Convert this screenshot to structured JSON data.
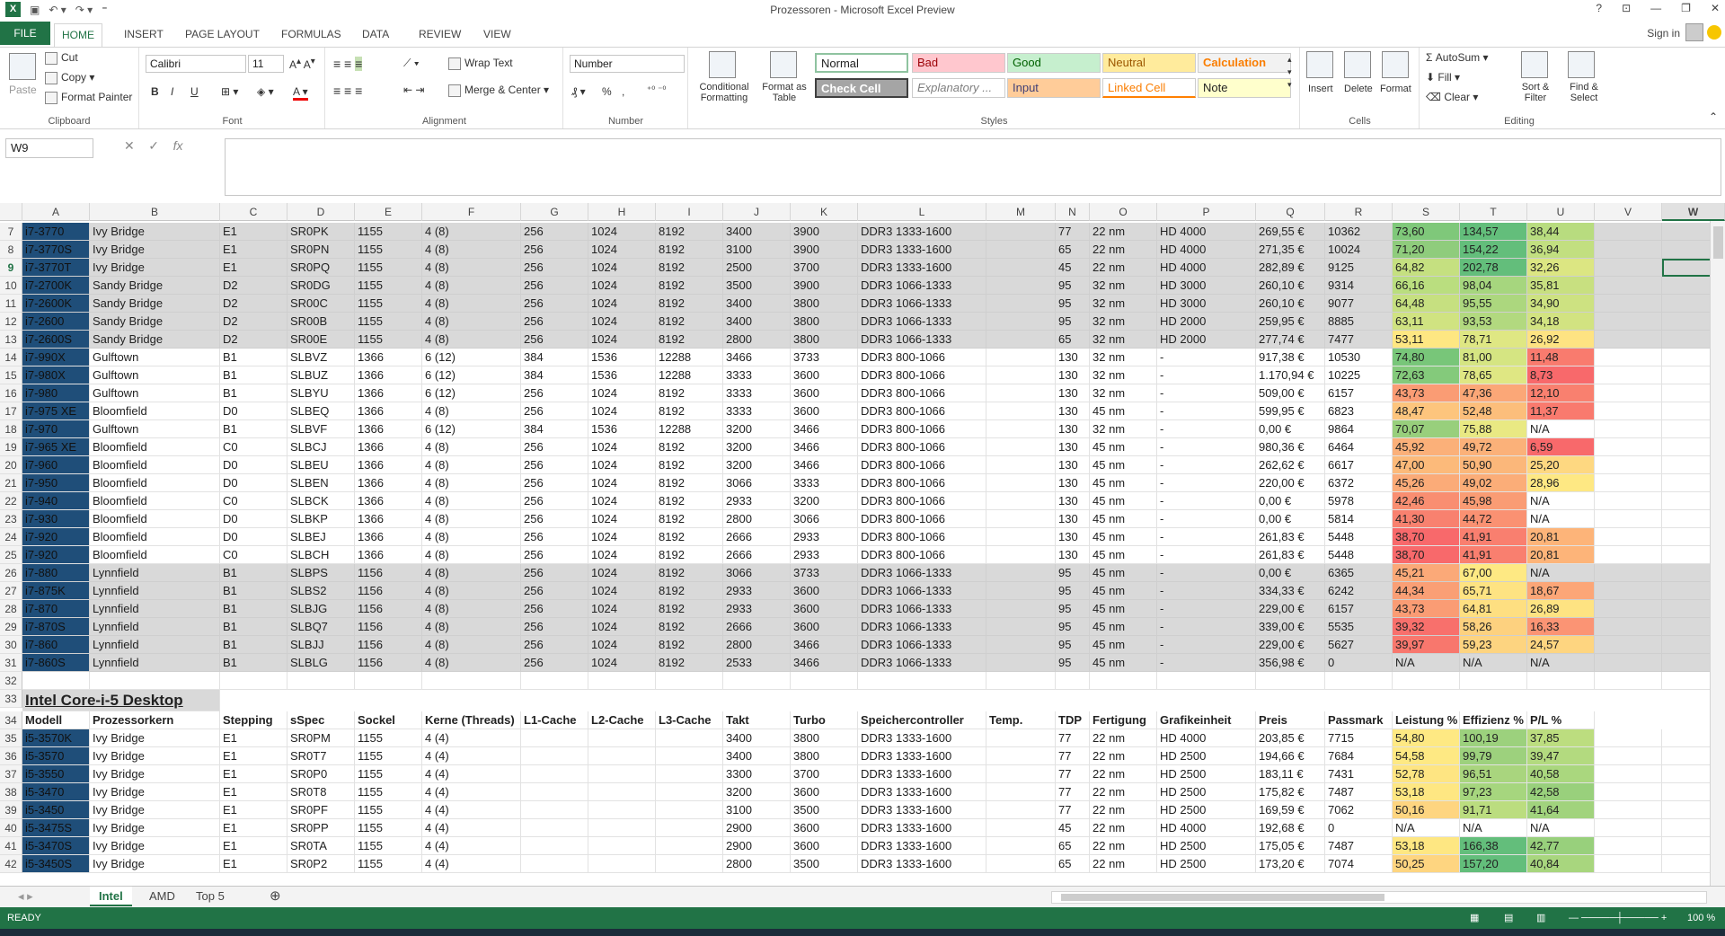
{
  "title": "Prozessoren - Microsoft Excel Preview",
  "tabs": {
    "file": "FILE",
    "home": "HOME",
    "insert": "INSERT",
    "page_layout": "PAGE LAYOUT",
    "formulas": "FORMULAS",
    "data": "DATA",
    "review": "REVIEW",
    "view": "VIEW",
    "signin": "Sign in"
  },
  "clipboard": {
    "paste": "Paste",
    "cut": "Cut",
    "copy": "Copy",
    "format_painter": "Format Painter",
    "label": "Clipboard"
  },
  "font": {
    "name": "Calibri",
    "size": "11",
    "label": "Font",
    "bold": "B",
    "italic": "I",
    "underline": "U"
  },
  "alignment": {
    "wrap": "Wrap Text",
    "merge": "Merge & Center",
    "label": "Alignment"
  },
  "number": {
    "format": "Number",
    "pct": "%",
    "label": "Number"
  },
  "styles": {
    "cond": "Conditional Formatting",
    "fmt_table": "Format as Table",
    "label": "Styles",
    "normal": "Normal",
    "bad": "Bad",
    "good": "Good",
    "neutral": "Neutral",
    "calculation": "Calculation",
    "check": "Check Cell",
    "explanatory": "Explanatory ...",
    "input": "Input",
    "linked": "Linked Cell",
    "note": "Note"
  },
  "cells": {
    "insert": "Insert",
    "delete": "Delete",
    "format": "Format",
    "label": "Cells"
  },
  "editing": {
    "autosum": "AutoSum",
    "fill": "Fill",
    "clear": "Clear",
    "sort": "Sort & Filter",
    "find": "Find & Select",
    "label": "Editing"
  },
  "namebox": "W9",
  "fx": "fx",
  "columns": [
    "A",
    "B",
    "C",
    "D",
    "E",
    "F",
    "G",
    "H",
    "I",
    "J",
    "K",
    "L",
    "M",
    "N",
    "O",
    "P",
    "Q",
    "R",
    "S",
    "T",
    "U",
    "V",
    "W"
  ],
  "rows": [
    {
      "n": "7",
      "grey": true,
      "v": [
        "i7-3770",
        "Ivy Bridge",
        "E1",
        "SR0PK",
        "1155",
        "4 (8)",
        "256",
        "1024",
        "8192",
        "3400",
        "3900",
        "DDR3 1333-1600",
        "",
        "77",
        "22 nm",
        "HD 4000",
        "269,55 €",
        "10362",
        "73,60",
        "134,57",
        "38,44"
      ],
      "col": [
        "#7fc87a",
        "#63be7b",
        "#b8dc7f"
      ]
    },
    {
      "n": "8",
      "grey": true,
      "v": [
        "i7-3770S",
        "Ivy Bridge",
        "E1",
        "SR0PN",
        "1155",
        "4 (8)",
        "256",
        "1024",
        "8192",
        "3100",
        "3900",
        "DDR3 1333-1600",
        "",
        "65",
        "22 nm",
        "HD 4000",
        "271,35 €",
        "10024",
        "71,20",
        "154,22",
        "36,94"
      ],
      "col": [
        "#8fcc7c",
        "#63be7b",
        "#c2df80"
      ]
    },
    {
      "n": "9",
      "grey": true,
      "v": [
        "i7-3770T",
        "Ivy Bridge",
        "E1",
        "SR0PQ",
        "1155",
        "4 (8)",
        "256",
        "1024",
        "8192",
        "2500",
        "3700",
        "DDR3 1333-1600",
        "",
        "45",
        "22 nm",
        "HD 4000",
        "282,89 €",
        "9125",
        "64,82",
        "202,78",
        "32,26"
      ],
      "col": [
        "#c5e080",
        "#63be7b",
        "#dce682"
      ]
    },
    {
      "n": "10",
      "grey": true,
      "v": [
        "i7-2700K",
        "Sandy Bridge",
        "D2",
        "SR0DG",
        "1155",
        "4 (8)",
        "256",
        "1024",
        "8192",
        "3500",
        "3900",
        "DDR3 1066-1333",
        "",
        "95",
        "32 nm",
        "HD 3000",
        "260,10 €",
        "9314",
        "66,16",
        "98,04",
        "35,81"
      ],
      "col": [
        "#bade7f",
        "#a6d67e",
        "#c8e080"
      ]
    },
    {
      "n": "11",
      "grey": true,
      "v": [
        "i7-2600K",
        "Sandy Bridge",
        "D2",
        "SR00C",
        "1155",
        "4 (8)",
        "256",
        "1024",
        "8192",
        "3400",
        "3800",
        "DDR3 1066-1333",
        "",
        "95",
        "32 nm",
        "HD 3000",
        "260,10 €",
        "9077",
        "64,48",
        "95,55",
        "34,90"
      ],
      "col": [
        "#c6e080",
        "#acd77e",
        "#cde281"
      ]
    },
    {
      "n": "12",
      "grey": true,
      "v": [
        "i7-2600",
        "Sandy Bridge",
        "D2",
        "SR00B",
        "1155",
        "4 (8)",
        "256",
        "1024",
        "8192",
        "3400",
        "3800",
        "DDR3 1066-1333",
        "",
        "95",
        "32 nm",
        "HD 2000",
        "259,95 €",
        "8885",
        "63,11",
        "93,53",
        "34,18"
      ],
      "col": [
        "#d0e381",
        "#b2d97f",
        "#d2e381"
      ]
    },
    {
      "n": "13",
      "grey": true,
      "v": [
        "i7-2600S",
        "Sandy Bridge",
        "D2",
        "SR00E",
        "1155",
        "4 (8)",
        "256",
        "1024",
        "8192",
        "2800",
        "3800",
        "DDR3 1066-1333",
        "",
        "65",
        "32 nm",
        "HD 2000",
        "277,74 €",
        "7477",
        "53,11",
        "78,71",
        "26,92"
      ],
      "col": [
        "#fee782",
        "#dfe783",
        "#fee382"
      ]
    },
    {
      "n": "14",
      "grey": false,
      "v": [
        "i7-990X",
        "Gulftown",
        "B1",
        "SLBVZ",
        "1366",
        "6 (12)",
        "384",
        "1536",
        "12288",
        "3466",
        "3733",
        "DDR3 800-1066",
        "",
        "130",
        "32 nm",
        "-",
        "917,38 €",
        "10530",
        "74,80",
        "81,00",
        "11,48"
      ],
      "col": [
        "#78c679",
        "#d5e582",
        "#f97b6e"
      ]
    },
    {
      "n": "15",
      "grey": false,
      "v": [
        "i7-980X",
        "Gulftown",
        "B1",
        "SLBUZ",
        "1366",
        "6 (12)",
        "384",
        "1536",
        "12288",
        "3333",
        "3600",
        "DDR3 800-1066",
        "",
        "130",
        "32 nm",
        "-",
        "1.170,94 €",
        "10225",
        "72,63",
        "78,65",
        "8,73"
      ],
      "col": [
        "#84ca7b",
        "#dfe783",
        "#f8696b"
      ]
    },
    {
      "n": "16",
      "grey": false,
      "v": [
        "i7-980",
        "Gulftown",
        "B1",
        "SLBYU",
        "1366",
        "6 (12)",
        "256",
        "1024",
        "8192",
        "3333",
        "3600",
        "DDR3 800-1066",
        "",
        "130",
        "32 nm",
        "-",
        "509,00 €",
        "6157",
        "43,73",
        "47,36",
        "12,10"
      ],
      "col": [
        "#fa9c74",
        "#fba777",
        "#f9806f"
      ]
    },
    {
      "n": "17",
      "grey": false,
      "v": [
        "i7-975 XE",
        "Bloomfield",
        "D0",
        "SLBEQ",
        "1366",
        "4 (8)",
        "256",
        "1024",
        "8192",
        "3333",
        "3600",
        "DDR3 800-1066",
        "",
        "130",
        "45 nm",
        "-",
        "599,95 €",
        "6823",
        "48,47",
        "52,48",
        "11,37"
      ],
      "col": [
        "#fdc57d",
        "#fcbe7b",
        "#f97a6e"
      ]
    },
    {
      "n": "18",
      "grey": false,
      "v": [
        "i7-970",
        "Gulftown",
        "B1",
        "SLBVF",
        "1366",
        "6 (12)",
        "384",
        "1536",
        "12288",
        "3200",
        "3466",
        "DDR3 800-1066",
        "",
        "130",
        "32 nm",
        "-",
        "0,00 €",
        "9864",
        "70,07",
        "75,88",
        "N/A"
      ],
      "col": [
        "#98cf7c",
        "#e9e983",
        "#ffffff"
      ]
    },
    {
      "n": "19",
      "grey": false,
      "v": [
        "i7-965 XE",
        "Bloomfield",
        "C0",
        "SLBCJ",
        "1366",
        "4 (8)",
        "256",
        "1024",
        "8192",
        "3200",
        "3466",
        "DDR3 800-1066",
        "",
        "130",
        "45 nm",
        "-",
        "980,36 €",
        "6464",
        "45,92",
        "49,72",
        "6,59"
      ],
      "col": [
        "#fbb079",
        "#fbb179",
        "#f8696b"
      ]
    },
    {
      "n": "20",
      "grey": false,
      "v": [
        "i7-960",
        "Bloomfield",
        "D0",
        "SLBEU",
        "1366",
        "4 (8)",
        "256",
        "1024",
        "8192",
        "3200",
        "3466",
        "DDR3 800-1066",
        "",
        "130",
        "45 nm",
        "-",
        "262,62 €",
        "6617",
        "47,00",
        "50,90",
        "25,20"
      ],
      "col": [
        "#fcba7a",
        "#fbb77a",
        "#fed881"
      ]
    },
    {
      "n": "21",
      "grey": false,
      "v": [
        "i7-950",
        "Bloomfield",
        "D0",
        "SLBEN",
        "1366",
        "4 (8)",
        "256",
        "1024",
        "8192",
        "3066",
        "3333",
        "DDR3 800-1066",
        "",
        "130",
        "45 nm",
        "-",
        "220,00 €",
        "6372",
        "45,26",
        "49,02",
        "28,96"
      ],
      "col": [
        "#fbab78",
        "#fbad78",
        "#fee883"
      ]
    },
    {
      "n": "22",
      "grey": false,
      "v": [
        "i7-940",
        "Bloomfield",
        "C0",
        "SLBCK",
        "1366",
        "4 (8)",
        "256",
        "1024",
        "8192",
        "2933",
        "3200",
        "DDR3 800-1066",
        "",
        "130",
        "45 nm",
        "-",
        "0,00 €",
        "5978",
        "42,46",
        "45,98",
        "N/A"
      ],
      "col": [
        "#f98e71",
        "#fa9c74",
        "#ffffff"
      ]
    },
    {
      "n": "23",
      "grey": false,
      "v": [
        "i7-930",
        "Bloomfield",
        "D0",
        "SLBKP",
        "1366",
        "4 (8)",
        "256",
        "1024",
        "8192",
        "2800",
        "3066",
        "DDR3 800-1066",
        "",
        "130",
        "45 nm",
        "-",
        "0,00 €",
        "5814",
        "41,30",
        "44,72",
        "N/A"
      ],
      "col": [
        "#f8816f",
        "#fa9172",
        "#ffffff"
      ]
    },
    {
      "n": "24",
      "grey": false,
      "v": [
        "i7-920",
        "Bloomfield",
        "D0",
        "SLBEJ",
        "1366",
        "4 (8)",
        "256",
        "1024",
        "8192",
        "2666",
        "2933",
        "DDR3 800-1066",
        "",
        "130",
        "45 nm",
        "-",
        "261,83 €",
        "5448",
        "38,70",
        "41,91",
        "20,81"
      ],
      "col": [
        "#f8696b",
        "#f97f6f",
        "#fdb479"
      ]
    },
    {
      "n": "25",
      "grey": false,
      "v": [
        "i7-920",
        "Bloomfield",
        "C0",
        "SLBCH",
        "1366",
        "4 (8)",
        "256",
        "1024",
        "8192",
        "2666",
        "2933",
        "DDR3 800-1066",
        "",
        "130",
        "45 nm",
        "-",
        "261,83 €",
        "5448",
        "38,70",
        "41,91",
        "20,81"
      ],
      "col": [
        "#f8696b",
        "#f97f6f",
        "#fdb479"
      ]
    },
    {
      "n": "26",
      "grey": true,
      "v": [
        "i7-880",
        "Lynnfield",
        "B1",
        "SLBPS",
        "1156",
        "4 (8)",
        "256",
        "1024",
        "8192",
        "3066",
        "3733",
        "DDR3 1066-1333",
        "",
        "95",
        "45 nm",
        "-",
        "0,00 €",
        "6365",
        "45,21",
        "67,00",
        "N/A"
      ],
      "col": [
        "#fba978",
        "#fee983",
        "#d9d9d9"
      ]
    },
    {
      "n": "27",
      "grey": true,
      "v": [
        "i7-875K",
        "Lynnfield",
        "B1",
        "SLBS2",
        "1156",
        "4 (8)",
        "256",
        "1024",
        "8192",
        "2933",
        "3600",
        "DDR3 1066-1333",
        "",
        "95",
        "45 nm",
        "-",
        "334,33 €",
        "6242",
        "44,34",
        "65,71",
        "18,67"
      ],
      "col": [
        "#fa9f75",
        "#fee382",
        "#fca677"
      ]
    },
    {
      "n": "28",
      "grey": true,
      "v": [
        "i7-870",
        "Lynnfield",
        "B1",
        "SLBJG",
        "1156",
        "4 (8)",
        "256",
        "1024",
        "8192",
        "2933",
        "3600",
        "DDR3 1066-1333",
        "",
        "95",
        "45 nm",
        "-",
        "229,00 €",
        "6157",
        "43,73",
        "64,81",
        "26,89"
      ],
      "col": [
        "#fa9c74",
        "#fedf81",
        "#fee382"
      ]
    },
    {
      "n": "29",
      "grey": true,
      "v": [
        "i7-870S",
        "Lynnfield",
        "B1",
        "SLBQ7",
        "1156",
        "4 (8)",
        "256",
        "1024",
        "8192",
        "2666",
        "3600",
        "DDR3 1066-1333",
        "",
        "95",
        "45 nm",
        "-",
        "339,00 €",
        "5535",
        "39,32",
        "58,26",
        "16,33"
      ],
      "col": [
        "#f8706c",
        "#fdd17f",
        "#fb9474"
      ]
    },
    {
      "n": "30",
      "grey": true,
      "v": [
        "i7-860",
        "Lynnfield",
        "B1",
        "SLBJJ",
        "1156",
        "4 (8)",
        "256",
        "1024",
        "8192",
        "2800",
        "3466",
        "DDR3 1066-1333",
        "",
        "95",
        "45 nm",
        "-",
        "229,00 €",
        "5627",
        "39,97",
        "59,23",
        "24,57"
      ],
      "col": [
        "#f8776d",
        "#fdd480",
        "#fed580"
      ]
    },
    {
      "n": "31",
      "grey": true,
      "v": [
        "i7-860S",
        "Lynnfield",
        "B1",
        "SLBLG",
        "1156",
        "4 (8)",
        "256",
        "1024",
        "8192",
        "2533",
        "3466",
        "DDR3 1066-1333",
        "",
        "95",
        "45 nm",
        "-",
        "356,98 €",
        "0",
        "N/A",
        "N/A",
        "N/A"
      ],
      "col": [
        "#d9d9d9",
        "#d9d9d9",
        "#d9d9d9"
      ]
    }
  ],
  "section_title": "Intel Core-i-5 Desktop",
  "headers": [
    "Modell",
    "Prozessorkern",
    "Stepping",
    "sSpec",
    "Sockel",
    "Kerne (Threads)",
    "L1-Cache",
    "L2-Cache",
    "L3-Cache",
    "Takt",
    "Turbo",
    "Speichercontroller",
    "Temp.",
    "TDP",
    "Fertigung",
    "Grafikeinheit",
    "Preis",
    "Passmark",
    "Leistung %",
    "Effizienz %",
    "P/L %"
  ],
  "rows2": [
    {
      "n": "35",
      "v": [
        "i5-3570K",
        "Ivy Bridge",
        "E1",
        "SR0PM",
        "1155",
        "4 (4)",
        "",
        "",
        "",
        "3400",
        "3800",
        "DDR3 1333-1600",
        "",
        "77",
        "22 nm",
        "HD 4000",
        "203,85 €",
        "7715",
        "54,80",
        "100,19",
        "37,85"
      ],
      "col": [
        "#fee983",
        "#9cd17d",
        "#bcdd7f"
      ]
    },
    {
      "n": "36",
      "v": [
        "i5-3570",
        "Ivy Bridge",
        "E1",
        "SR0T7",
        "1155",
        "4 (4)",
        "",
        "",
        "",
        "3400",
        "3800",
        "DDR3 1333-1600",
        "",
        "77",
        "22 nm",
        "HD 2500",
        "194,66 €",
        "7684",
        "54,58",
        "99,79",
        "39,47"
      ],
      "col": [
        "#fee983",
        "#9dd17d",
        "#b3da7f"
      ]
    },
    {
      "n": "37",
      "v": [
        "i5-3550",
        "Ivy Bridge",
        "E1",
        "SR0P0",
        "1155",
        "4 (4)",
        "",
        "",
        "",
        "3300",
        "3700",
        "DDR3 1333-1600",
        "",
        "77",
        "22 nm",
        "HD 2500",
        "183,11 €",
        "7431",
        "52,78",
        "96,51",
        "40,58"
      ],
      "col": [
        "#fee582",
        "#a9d57e",
        "#aad77e"
      ]
    },
    {
      "n": "38",
      "v": [
        "i5-3470",
        "Ivy Bridge",
        "E1",
        "SR0T8",
        "1155",
        "4 (4)",
        "",
        "",
        "",
        "3200",
        "3600",
        "DDR3 1333-1600",
        "",
        "77",
        "22 nm",
        "HD 2500",
        "175,82 €",
        "7487",
        "53,18",
        "97,23",
        "42,58"
      ],
      "col": [
        "#fee782",
        "#a6d67e",
        "#99d07c"
      ]
    },
    {
      "n": "39",
      "v": [
        "i5-3450",
        "Ivy Bridge",
        "E1",
        "SR0PF",
        "1155",
        "4 (4)",
        "",
        "",
        "",
        "3100",
        "3500",
        "DDR3 1333-1600",
        "",
        "77",
        "22 nm",
        "HD 2500",
        "169,59 €",
        "7062",
        "50,16",
        "91,71",
        "41,64"
      ],
      "col": [
        "#fed580",
        "#bbdd7f",
        "#a1d37d"
      ]
    },
    {
      "n": "40",
      "v": [
        "i5-3475S",
        "Ivy Bridge",
        "E1",
        "SR0PP",
        "1155",
        "4 (4)",
        "",
        "",
        "",
        "2900",
        "3600",
        "DDR3 1333-1600",
        "",
        "45",
        "22 nm",
        "HD 4000",
        "192,68 €",
        "0",
        "N/A",
        "N/A",
        "N/A"
      ],
      "col": [
        "#ffffff",
        "#ffffff",
        "#ffffff"
      ]
    },
    {
      "n": "41",
      "v": [
        "i5-3470S",
        "Ivy Bridge",
        "E1",
        "SR0TA",
        "1155",
        "4 (4)",
        "",
        "",
        "",
        "2900",
        "3600",
        "DDR3 1333-1600",
        "",
        "65",
        "22 nm",
        "HD 2500",
        "175,05 €",
        "7487",
        "53,18",
        "166,38",
        "42,77"
      ],
      "col": [
        "#fee782",
        "#63be7b",
        "#98d07c"
      ]
    },
    {
      "n": "42",
      "v": [
        "i5-3450S",
        "Ivy Bridge",
        "E1",
        "SR0P2",
        "1155",
        "4 (4)",
        "",
        "",
        "",
        "2800",
        "3500",
        "DDR3 1333-1600",
        "",
        "65",
        "22 nm",
        "HD 2500",
        "173,20 €",
        "7074",
        "50,25",
        "157,20",
        "40,84"
      ],
      "col": [
        "#fed580",
        "#63be7b",
        "#a8d67e"
      ]
    }
  ],
  "sheet_tabs": [
    "Intel",
    "AMD",
    "Top 5"
  ],
  "status": {
    "ready": "READY",
    "zoom": "100 %"
  }
}
